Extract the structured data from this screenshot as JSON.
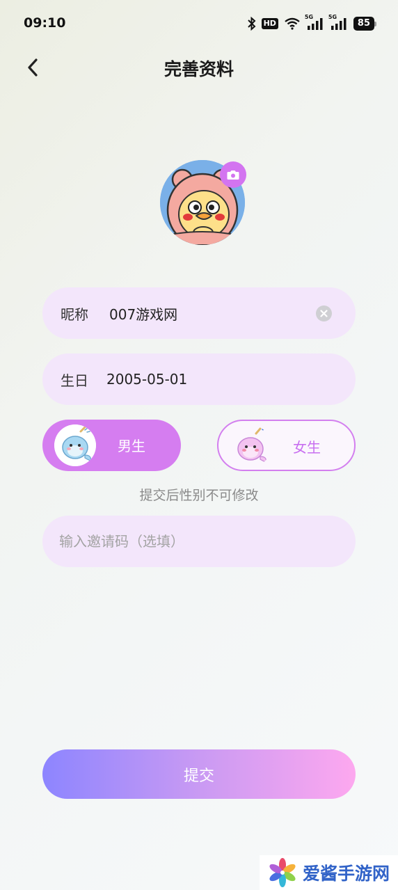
{
  "status_bar": {
    "time": "09:10",
    "hd": "HD",
    "net1": "5G",
    "net2": "5G",
    "battery": "85"
  },
  "header": {
    "title": "完善资料"
  },
  "form": {
    "nickname": {
      "label": "昵称",
      "value": "007游戏网"
    },
    "birthday": {
      "label": "生日",
      "value": "2005-05-01"
    },
    "gender": {
      "male_label": "男生",
      "female_label": "女生",
      "selected": "male",
      "hint": "提交后性别不可修改"
    },
    "invite": {
      "placeholder": "输入邀请码（选填）"
    },
    "submit_label": "提交"
  },
  "watermark": {
    "text": "爱酱手游网"
  },
  "colors": {
    "accent": "#d57df0",
    "field_bg": "#f3e6fb",
    "submit_start": "#8d85ff",
    "submit_end": "#fda8ef"
  },
  "icons": [
    "back-icon",
    "camera-icon",
    "clear-icon",
    "bluetooth-icon",
    "wifi-icon",
    "signal-icon",
    "battery-icon"
  ]
}
